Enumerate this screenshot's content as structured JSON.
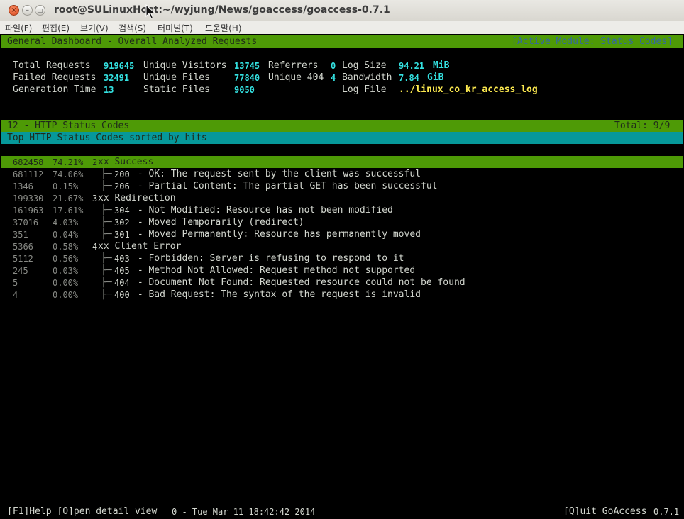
{
  "window": {
    "title": "root@SULinuxHost:~/wyjung/News/goaccess/goaccess-0.7.1",
    "close_glyph": "×",
    "min_glyph": "–",
    "max_glyph": "□"
  },
  "menu": [
    "파일(F)",
    "편집(E)",
    "보기(V)",
    "검색(S)",
    "터미널(T)",
    "도움말(H)"
  ],
  "header": {
    "title": "General Dashboard - Overall Analyzed Requests",
    "active_module": "[Active Module: Status Codes]"
  },
  "stats": {
    "total_requests_label": "Total Requests",
    "total_requests": "919645",
    "unique_visitors_label": "Unique Visitors",
    "unique_visitors": "13745",
    "referrers_label": "Referrers",
    "referrers": "0",
    "log_size_label": "Log Size",
    "log_size": "94.21",
    "log_size_unit": "MiB",
    "failed_requests_label": "Failed Requests",
    "failed_requests": "32491",
    "unique_files_label": "Unique Files",
    "unique_files": "77840",
    "unique_404_label": "Unique 404",
    "unique_404": "4",
    "bandwidth_label": "Bandwidth",
    "bandwidth": "7.84",
    "bandwidth_unit": "GiB",
    "generation_time_label": "Generation Time",
    "generation_time": "13",
    "static_files_label": "Static Files",
    "static_files": "9050",
    "log_file_label": "Log File",
    "log_file": "../linux_co_kr_access_log"
  },
  "module": {
    "title": "12 - HTTP Status Codes",
    "total": "Total: 9/9",
    "subtitle": "Top HTTP Status Codes sorted by hits"
  },
  "rows": [
    {
      "hits": "682458",
      "percent": "74.21%",
      "tree": "",
      "code": "2",
      "label": "xx Success",
      "selected": true,
      "group": true
    },
    {
      "hits": "681112",
      "percent": "74.06%",
      "tree": "├─",
      "code": "200",
      "label": " - OK: The request sent by the client was successful"
    },
    {
      "hits": "1346",
      "percent": "0.15%",
      "tree": "├─",
      "code": "206",
      "label": " - Partial Content: The partial GET has been successful"
    },
    {
      "hits": "199330",
      "percent": "21.67%",
      "tree": "",
      "code": "3",
      "label": "xx Redirection",
      "group": true
    },
    {
      "hits": "161963",
      "percent": "17.61%",
      "tree": "├─",
      "code": "304",
      "label": " - Not Modified: Resource has not been modified"
    },
    {
      "hits": "37016",
      "percent": "4.03%",
      "tree": "├─",
      "code": "302",
      "label": " - Moved Temporarily (redirect)"
    },
    {
      "hits": "351",
      "percent": "0.04%",
      "tree": "├─",
      "code": "301",
      "label": " - Moved Permanently: Resource has permanently moved"
    },
    {
      "hits": "5366",
      "percent": "0.58%",
      "tree": "",
      "code": "4",
      "label": "xx Client Error",
      "group": true
    },
    {
      "hits": "5112",
      "percent": "0.56%",
      "tree": "├─",
      "code": "403",
      "label": " - Forbidden: Server is refusing to respond to it"
    },
    {
      "hits": "245",
      "percent": "0.03%",
      "tree": "├─",
      "code": "405",
      "label": " - Method Not Allowed: Request method not supported"
    },
    {
      "hits": "5",
      "percent": "0.00%",
      "tree": "├─",
      "code": "404",
      "label": " - Document Not Found: Requested resource could not be found"
    },
    {
      "hits": "4",
      "percent": "0.00%",
      "tree": "├─",
      "code": "400",
      "label": " - Bad Request: The syntax of the request is invalid"
    }
  ],
  "footer": {
    "help": "[F1]Help [O]pen detail view",
    "status": "0 - Tue Mar 11 18:42:42 2014",
    "quit": "[Q]uit GoAccess",
    "version": "0.7.1"
  }
}
